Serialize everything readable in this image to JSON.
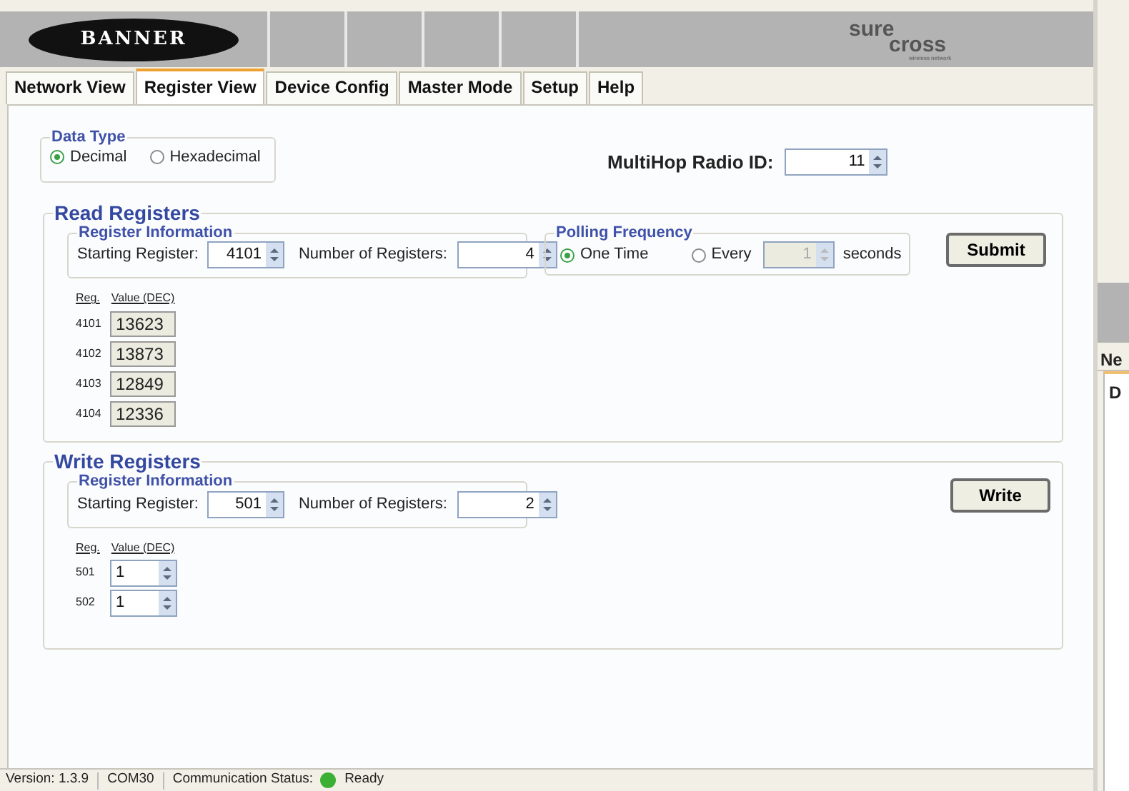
{
  "header": {
    "logo": "BANNER",
    "brand_top": "sure",
    "brand_bottom": "cross",
    "brand_tagline": "wireless network"
  },
  "tabs": [
    {
      "label": "Network View",
      "selected": false
    },
    {
      "label": "Register View",
      "selected": true
    },
    {
      "label": "Device Config",
      "selected": false
    },
    {
      "label": "Master Mode",
      "selected": false
    },
    {
      "label": "Setup",
      "selected": false
    },
    {
      "label": "Help",
      "selected": false
    }
  ],
  "data_type": {
    "legend": "Data Type",
    "options": [
      {
        "label": "Decimal",
        "selected": true
      },
      {
        "label": "Hexadecimal",
        "selected": false
      }
    ]
  },
  "radio_id": {
    "label": "MultiHop Radio ID:",
    "value": "11"
  },
  "read_registers": {
    "title": "Read Registers",
    "info": {
      "legend": "Register Information",
      "start_label": "Starting Register:",
      "start_value": "4101",
      "count_label": "Number of Registers:",
      "count_value": "4"
    },
    "polling": {
      "legend": "Polling Frequency",
      "options": [
        {
          "label": "One Time",
          "selected": true
        },
        {
          "label": "Every",
          "selected": false
        }
      ],
      "interval_value": "1",
      "interval_disabled": true,
      "unit": "seconds"
    },
    "button": "Submit",
    "columns": [
      "Reg.",
      "Value (DEC)"
    ],
    "rows": [
      {
        "reg": "4101",
        "value": "13623"
      },
      {
        "reg": "4102",
        "value": "13873"
      },
      {
        "reg": "4103",
        "value": "12849"
      },
      {
        "reg": "4104",
        "value": "12336"
      }
    ]
  },
  "write_registers": {
    "title": "Write Registers",
    "info": {
      "legend": "Register Information",
      "start_label": "Starting Register:",
      "start_value": "501",
      "count_label": "Number of Registers:",
      "count_value": "2"
    },
    "button": "Write",
    "columns": [
      "Reg.",
      "Value (DEC)"
    ],
    "rows": [
      {
        "reg": "501",
        "value": "1"
      },
      {
        "reg": "502",
        "value": "1"
      }
    ]
  },
  "status_bar": {
    "version": "Version: 1.3.9",
    "port": "COM30",
    "status_label": "Communication Status:",
    "status_text": "Ready"
  },
  "background_window": {
    "tab": "Ne",
    "item": "D"
  }
}
